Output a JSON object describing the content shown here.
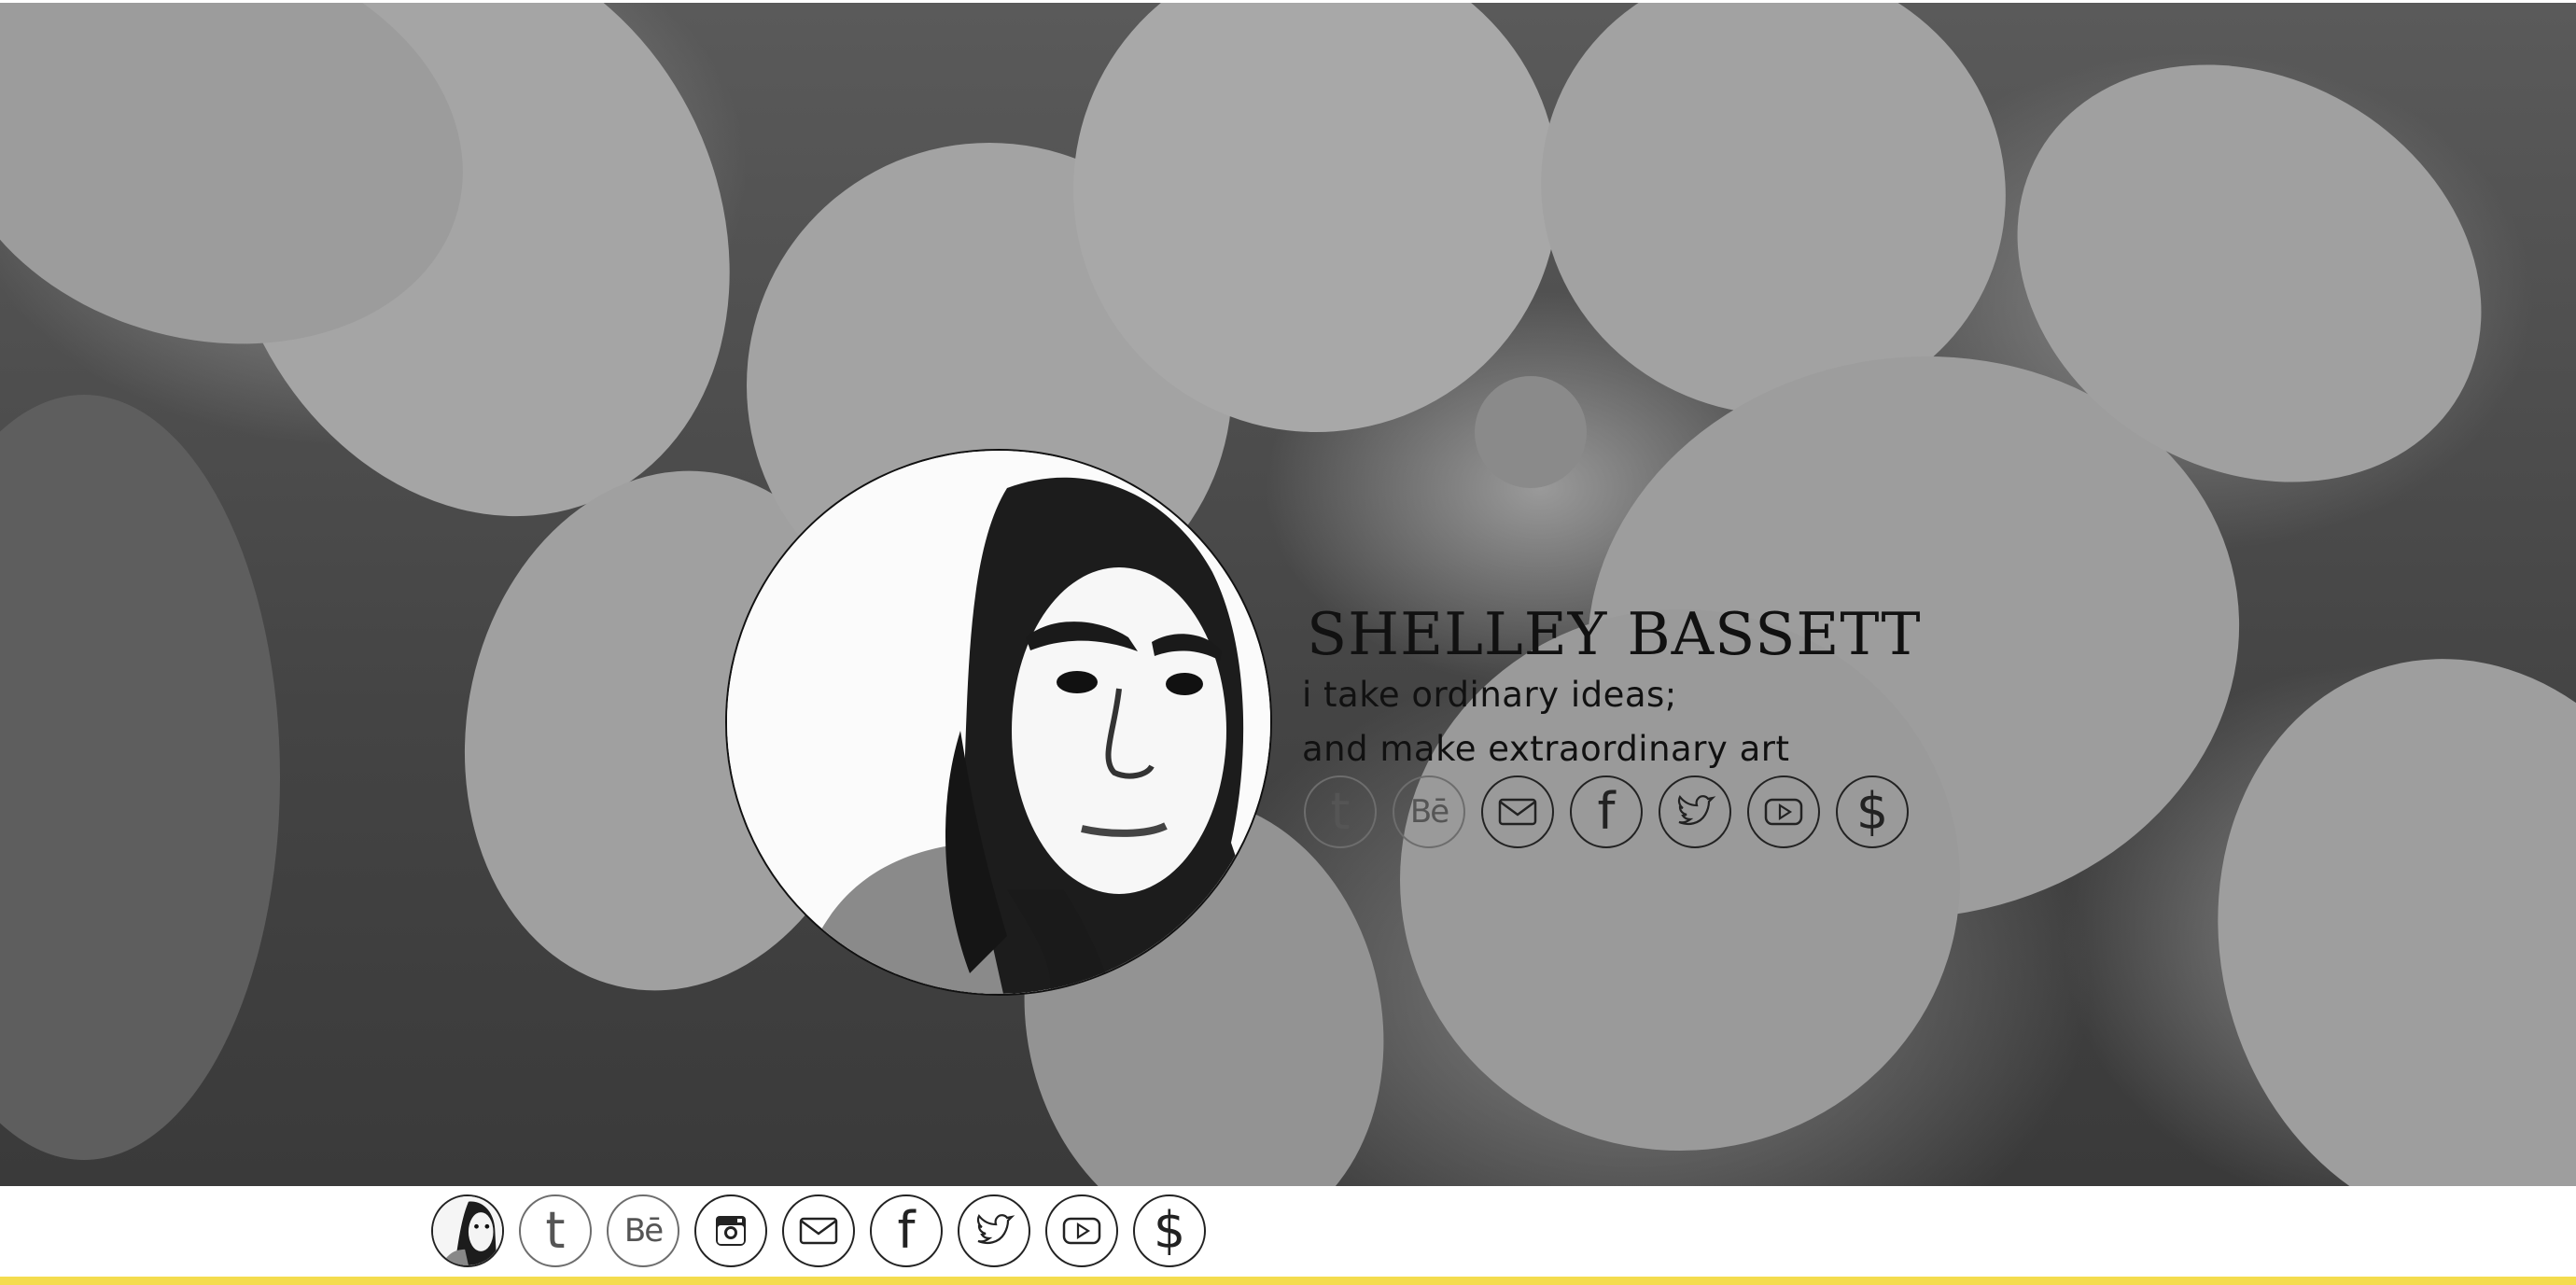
{
  "profile": {
    "name": "SHELLEY BASSETT",
    "tagline_line1": "i take ordinary ideas;",
    "tagline_line2": "and make extraordinary art"
  },
  "hero_icons": [
    {
      "icon": "tumblr-icon",
      "glyph": "t"
    },
    {
      "icon": "behance-icon",
      "glyph": "Bē"
    },
    {
      "icon": "email-icon",
      "glyph": ""
    },
    {
      "icon": "facebook-icon",
      "glyph": "f"
    },
    {
      "icon": "twitter-icon",
      "glyph": ""
    },
    {
      "icon": "youtube-icon",
      "glyph": ""
    },
    {
      "icon": "dollar-icon",
      "glyph": "$"
    }
  ],
  "bar_icons": [
    {
      "icon": "avatar-icon",
      "glyph": ""
    },
    {
      "icon": "tumblr-icon",
      "glyph": "t"
    },
    {
      "icon": "behance-icon",
      "glyph": "Bē"
    },
    {
      "icon": "instagram-icon",
      "glyph": ""
    },
    {
      "icon": "email-icon",
      "glyph": ""
    },
    {
      "icon": "facebook-icon",
      "glyph": "f"
    },
    {
      "icon": "twitter-icon",
      "glyph": ""
    },
    {
      "icon": "youtube-icon",
      "glyph": ""
    },
    {
      "icon": "dollar-icon",
      "glyph": "$"
    }
  ],
  "colors": {
    "accent_rule": "#f4dc4e",
    "background": "#ffffff",
    "text": "#111111"
  }
}
